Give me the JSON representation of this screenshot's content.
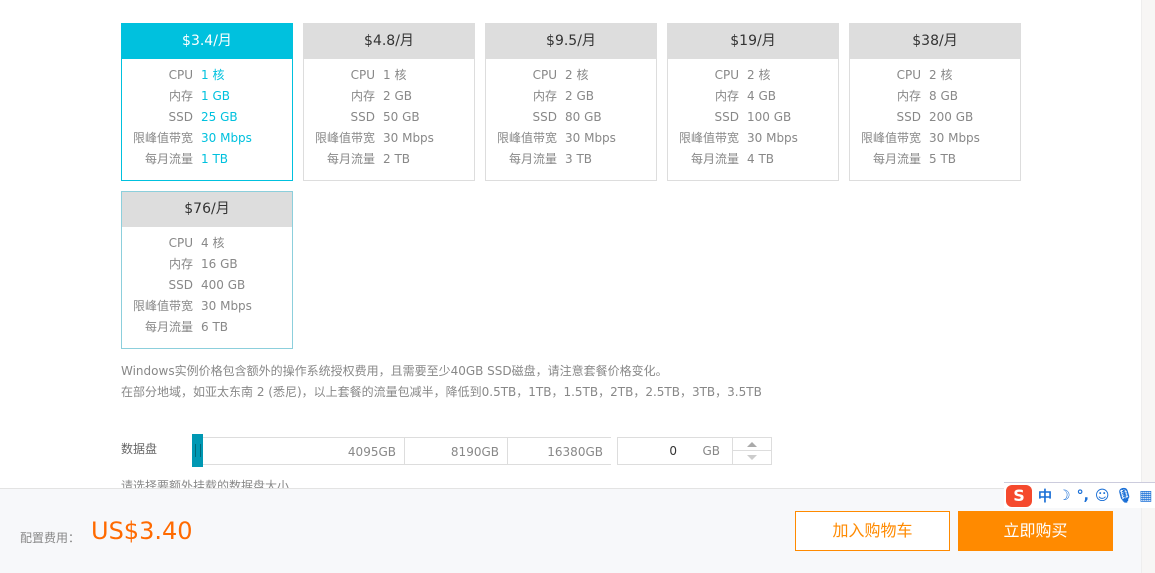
{
  "plans": [
    {
      "price": "$3.4/月",
      "selected": true,
      "cpu": "1 核",
      "memory": "1 GB",
      "ssd": "25 GB",
      "bandwidth": "30 Mbps",
      "traffic": "1 TB"
    },
    {
      "price": "$4.8/月",
      "selected": false,
      "cpu": "1 核",
      "memory": "2 GB",
      "ssd": "50 GB",
      "bandwidth": "30 Mbps",
      "traffic": "2 TB"
    },
    {
      "price": "$9.5/月",
      "selected": false,
      "cpu": "2 核",
      "memory": "2 GB",
      "ssd": "80 GB",
      "bandwidth": "30 Mbps",
      "traffic": "3 TB"
    },
    {
      "price": "$19/月",
      "selected": false,
      "cpu": "2 核",
      "memory": "4 GB",
      "ssd": "100 GB",
      "bandwidth": "30 Mbps",
      "traffic": "4 TB"
    },
    {
      "price": "$38/月",
      "selected": false,
      "cpu": "2 核",
      "memory": "8 GB",
      "ssd": "200 GB",
      "bandwidth": "30 Mbps",
      "traffic": "5 TB"
    },
    {
      "price": "$76/月",
      "selected": false,
      "cpu": "4 核",
      "memory": "16 GB",
      "ssd": "400 GB",
      "bandwidth": "30 Mbps",
      "traffic": "6 TB"
    }
  ],
  "spec_labels": {
    "cpu": "CPU",
    "memory": "内存",
    "ssd": "SSD",
    "bandwidth": "限峰值带宽",
    "traffic": "每月流量"
  },
  "notes": [
    "Windows实例价格包含额外的操作系统授权费用，且需要至少40GB SSD磁盘，请注意套餐价格变化。",
    "在部分地域，如亚太东南 2 (悉尼)，以上套餐的流量包减半，降低到0.5TB，1TB，1.5TB，2TB，2.5TB，3TB，3.5TB"
  ],
  "data_disk": {
    "label": "数据盘",
    "ticks": [
      "4095GB",
      "8190GB",
      "16380GB"
    ],
    "value": "0",
    "unit": "GB",
    "slider_fraction": 0,
    "hint": "请选择要额外挂载的数据盘大小"
  },
  "footer": {
    "fee_label": "配置费用：",
    "fee_value": "US$3.40",
    "add_to_cart": "加入购物车",
    "buy_now": "立即购买"
  },
  "ime_toolbar": {
    "logo": "S",
    "mode": "中",
    "items": [
      "moon-icon",
      "punctuation-icon",
      "emoji-icon",
      "microphone-icon",
      "keyboard-icon"
    ]
  },
  "colors": {
    "accent": "#00c1de",
    "orange": "#ff8a00",
    "price": "#ff6a00"
  }
}
